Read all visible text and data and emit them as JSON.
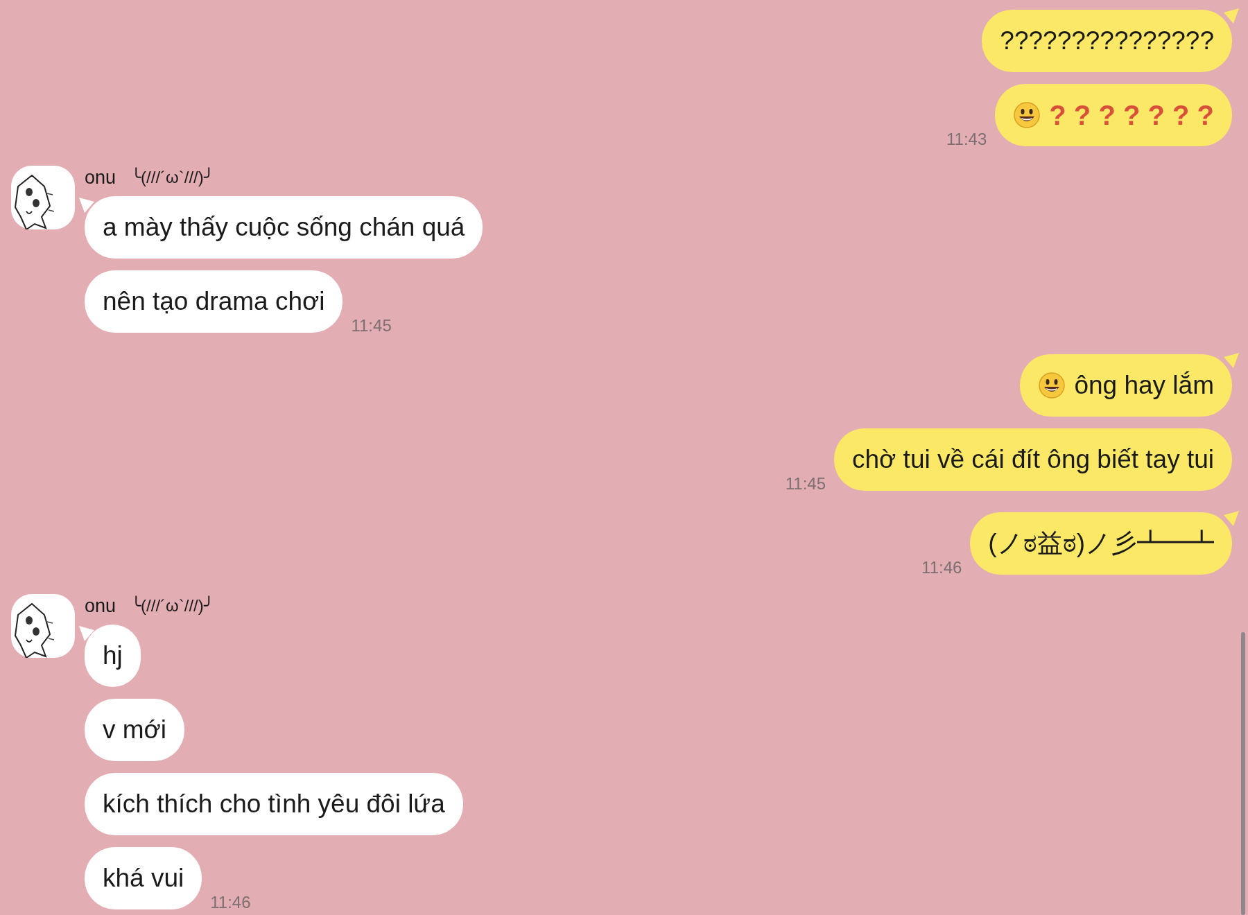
{
  "groups": [
    {
      "kind": "outgoing",
      "time": "11:43",
      "messages": [
        {
          "kind": "text",
          "text": "???????????????",
          "tail": true
        },
        {
          "kind": "smiley_questions",
          "text": "? ? ? ? ? ? ?",
          "tail": false
        }
      ]
    },
    {
      "kind": "incoming",
      "sender": {
        "name": "onu",
        "kaomoji": "╰(///´ω`///)╯"
      },
      "time": "11:45",
      "messages": [
        {
          "kind": "text",
          "text": "a mày thấy cuộc sống chán quá",
          "tail": true
        },
        {
          "kind": "text",
          "text": "nên tạo drama chơi",
          "tail": false
        }
      ]
    },
    {
      "kind": "outgoing",
      "time": "11:45",
      "messages": [
        {
          "kind": "smiley_text",
          "text": "ông hay lắm",
          "tail": true
        },
        {
          "kind": "text",
          "text": "chờ tui về cái đít ông biết tay tui",
          "tail": false
        }
      ]
    },
    {
      "kind": "outgoing",
      "time": "11:46",
      "messages": [
        {
          "kind": "text",
          "text": "(ノಠ益ಠ)ノ彡┻━┻",
          "tail": true
        }
      ]
    },
    {
      "kind": "incoming",
      "sender": {
        "name": "onu",
        "kaomoji": "╰(///´ω`///)╯"
      },
      "time": "11:46",
      "messages": [
        {
          "kind": "text",
          "text": "hj",
          "tail": true
        },
        {
          "kind": "text",
          "text": "v mới",
          "tail": false
        },
        {
          "kind": "text",
          "text": "kích thích cho tình yêu đôi lứa",
          "tail": false
        },
        {
          "kind": "text",
          "text": "khá vui",
          "tail": false
        }
      ]
    }
  ]
}
